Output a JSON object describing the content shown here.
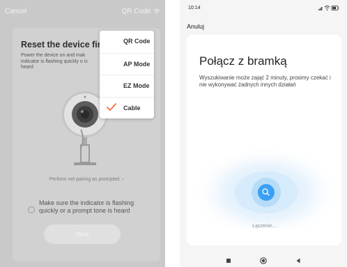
{
  "left_screen": {
    "cancel_label": "Cancel",
    "header_mode_label": "QR Code",
    "title": "Reset the device firs",
    "description": "Power the device on and mak indicator is flashing quickly o is heard",
    "hint": "Perform net pairing as prompted.",
    "confirm_text": "Make sure the indicator is flashing quickly or a prompt tone is heard",
    "next_label": "Next",
    "menu_items": [
      {
        "label": "QR Code",
        "checked": false
      },
      {
        "label": "AP Mode",
        "checked": false
      },
      {
        "label": "EZ Mode",
        "checked": false
      },
      {
        "label": "Cable",
        "checked": true
      }
    ],
    "icons": {
      "header": "wifi-icon",
      "camera": "camera-illustration",
      "check": "checkmark-icon"
    },
    "colors": {
      "accent": "#ff6a3d",
      "overlay": "#c9c9c9"
    }
  },
  "right_screen": {
    "time": "10:14",
    "back_label": "Anuluj",
    "title": "Połącz z bramką",
    "description": "Wyszukiwanie może zająć 2 minuty, prosimy czekać i nie wykonywać żadnych innych działań",
    "status_text": "Łączenie...",
    "icons": {
      "center": "search-icon",
      "status": [
        "signal-icon",
        "wifi-icon",
        "battery-icon"
      ],
      "nav": [
        "square-nav-icon",
        "circle-nav-icon",
        "back-triangle-icon"
      ]
    },
    "colors": {
      "accent": "#3aa0f5",
      "glow": "#cfe7fb"
    }
  }
}
